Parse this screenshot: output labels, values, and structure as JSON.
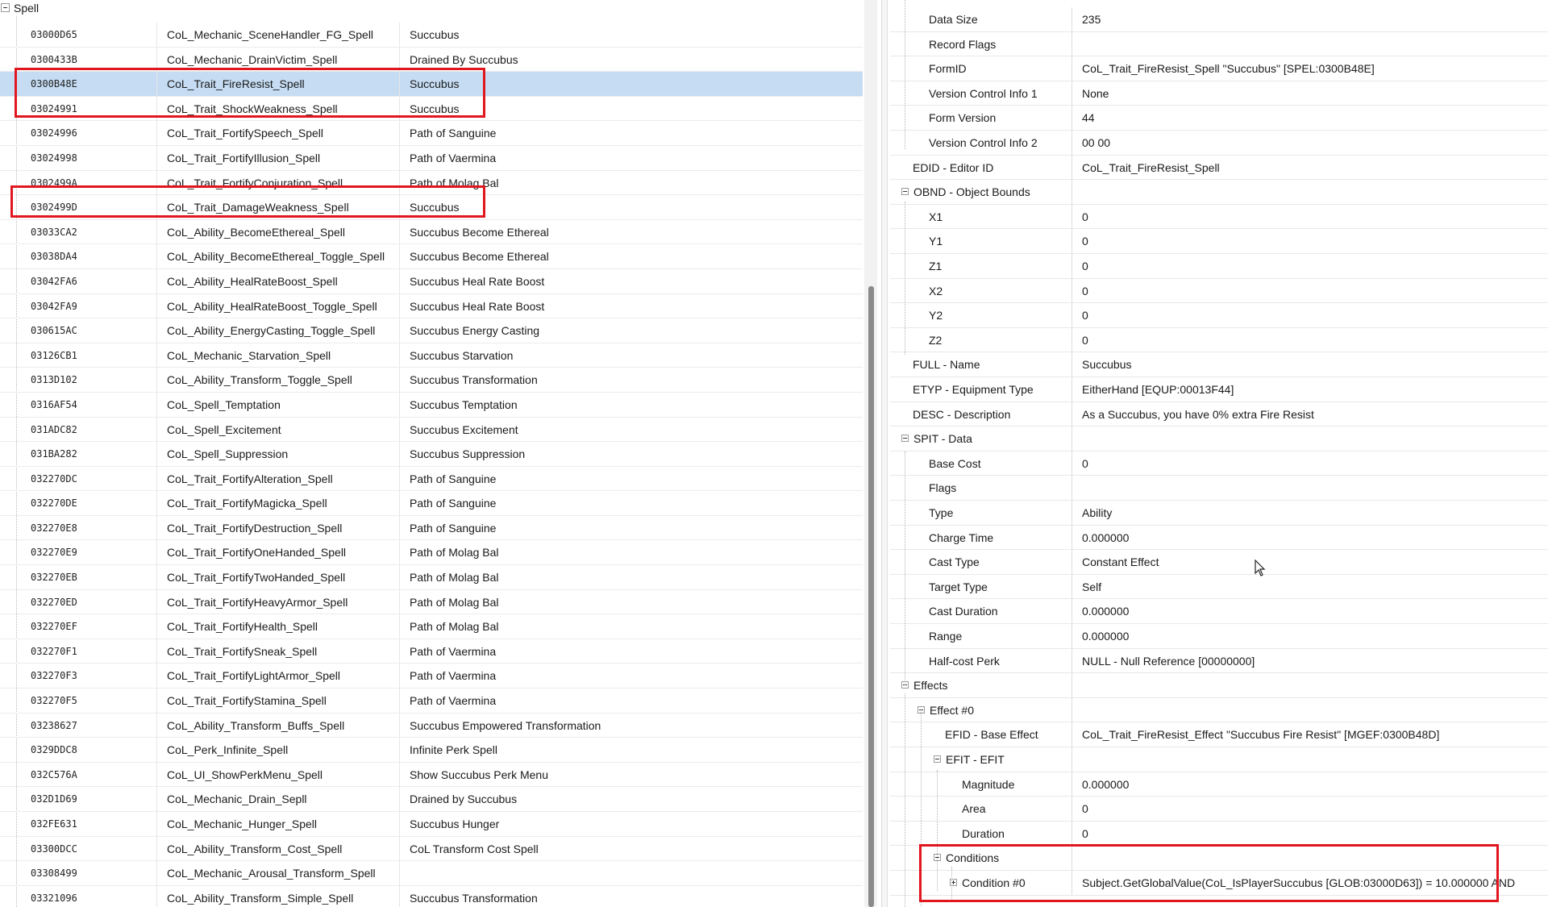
{
  "left_tree": {
    "root_label": "Spell",
    "rows": [
      {
        "id": "03000D65",
        "edid": "CoL_Mechanic_SceneHandler_FG_Spell",
        "name": "Succubus"
      },
      {
        "id": "0300433B",
        "edid": "CoL_Mechanic_DrainVictim_Spell",
        "name": "Drained By Succubus"
      },
      {
        "id": "0300B48E",
        "edid": "CoL_Trait_FireResist_Spell",
        "name": "Succubus",
        "selected": true
      },
      {
        "id": "03024991",
        "edid": "CoL_Trait_ShockWeakness_Spell",
        "name": "Succubus"
      },
      {
        "id": "03024996",
        "edid": "CoL_Trait_FortifySpeech_Spell",
        "name": "Path of Sanguine"
      },
      {
        "id": "03024998",
        "edid": "CoL_Trait_FortifyIllusion_Spell",
        "name": "Path of Vaermina"
      },
      {
        "id": "0302499A",
        "edid": "CoL_Trait_FortifyConjuration_Spell",
        "name": "Path of Molag Bal"
      },
      {
        "id": "0302499D",
        "edid": "CoL_Trait_DamageWeakness_Spell",
        "name": "Succubus"
      },
      {
        "id": "03033CA2",
        "edid": "CoL_Ability_BecomeEthereal_Spell",
        "name": "Succubus Become Ethereal"
      },
      {
        "id": "03038DA4",
        "edid": "CoL_Ability_BecomeEthereal_Toggle_Spell",
        "name": "Succubus Become Ethereal"
      },
      {
        "id": "03042FA6",
        "edid": "CoL_Ability_HealRateBoost_Spell",
        "name": "Succubus Heal Rate Boost"
      },
      {
        "id": "03042FA9",
        "edid": "CoL_Ability_HealRateBoost_Toggle_Spell",
        "name": "Succubus Heal Rate Boost"
      },
      {
        "id": "030615AC",
        "edid": "CoL_Ability_EnergyCasting_Toggle_Spell",
        "name": "Succubus Energy Casting"
      },
      {
        "id": "03126CB1",
        "edid": "CoL_Mechanic_Starvation_Spell",
        "name": "Succubus Starvation"
      },
      {
        "id": "0313D102",
        "edid": "CoL_Ability_Transform_Toggle_Spell",
        "name": "Succubus Transformation"
      },
      {
        "id": "0316AF54",
        "edid": "CoL_Spell_Temptation",
        "name": "Succubus Temptation"
      },
      {
        "id": "031ADC82",
        "edid": "CoL_Spell_Excitement",
        "name": "Succubus Excitement"
      },
      {
        "id": "031BA282",
        "edid": "CoL_Spell_Suppression",
        "name": "Succubus Suppression"
      },
      {
        "id": "032270DC",
        "edid": "CoL_Trait_FortifyAlteration_Spell",
        "name": "Path of Sanguine"
      },
      {
        "id": "032270DE",
        "edid": "CoL_Trait_FortifyMagicka_Spell",
        "name": "Path of Sanguine"
      },
      {
        "id": "032270E8",
        "edid": "CoL_Trait_FortifyDestruction_Spell",
        "name": "Path of Sanguine"
      },
      {
        "id": "032270E9",
        "edid": "CoL_Trait_FortifyOneHanded_Spell",
        "name": "Path of Molag Bal"
      },
      {
        "id": "032270EB",
        "edid": "CoL_Trait_FortifyTwoHanded_Spell",
        "name": "Path of Molag Bal"
      },
      {
        "id": "032270ED",
        "edid": "CoL_Trait_FortifyHeavyArmor_Spell",
        "name": "Path of Molag Bal"
      },
      {
        "id": "032270EF",
        "edid": "CoL_Trait_FortifyHealth_Spell",
        "name": "Path of Molag Bal"
      },
      {
        "id": "032270F1",
        "edid": "CoL_Trait_FortifySneak_Spell",
        "name": "Path of Vaermina"
      },
      {
        "id": "032270F3",
        "edid": "CoL_Trait_FortifyLightArmor_Spell",
        "name": "Path of Vaermina"
      },
      {
        "id": "032270F5",
        "edid": "CoL_Trait_FortifyStamina_Spell",
        "name": "Path of Vaermina"
      },
      {
        "id": "03238627",
        "edid": "CoL_Ability_Transform_Buffs_Spell",
        "name": "Succubus Empowered Transformation"
      },
      {
        "id": "0329DDC8",
        "edid": "CoL_Perk_Infinite_Spell",
        "name": "Infinite Perk Spell"
      },
      {
        "id": "032C576A",
        "edid": "CoL_UI_ShowPerkMenu_Spell",
        "name": "Show Succubus Perk Menu"
      },
      {
        "id": "032D1D69",
        "edid": "CoL_Mechanic_Drain_Sepll",
        "name": "Drained by Succubus"
      },
      {
        "id": "032FE631",
        "edid": "CoL_Mechanic_Hunger_Spell",
        "name": "Succubus Hunger"
      },
      {
        "id": "03300DCC",
        "edid": "CoL_Ability_Transform_Cost_Spell",
        "name": "CoL Transform Cost Spell"
      },
      {
        "id": "03308499",
        "edid": "CoL_Mechanic_Arousal_Transform_Spell",
        "name": ""
      },
      {
        "id": "03321096",
        "edid": "CoL_Ability_Transform_Simple_Spell",
        "name": "Succubus Transformation"
      }
    ]
  },
  "record_view": {
    "rows": [
      {
        "key": "Data Size",
        "value": "235",
        "indent": 1
      },
      {
        "key": "Record Flags",
        "value": "",
        "indent": 1
      },
      {
        "key": "FormID",
        "value": "CoL_Trait_FireResist_Spell \"Succubus\" [SPEL:0300B48E]",
        "indent": 1
      },
      {
        "key": "Version Control Info 1",
        "value": "None",
        "indent": 1
      },
      {
        "key": "Form Version",
        "value": "44",
        "indent": 1
      },
      {
        "key": "Version Control Info 2",
        "value": "00 00",
        "indent": 1
      },
      {
        "key": "EDID - Editor ID",
        "value": "CoL_Trait_FireResist_Spell",
        "indent": 0
      },
      {
        "key": "OBND - Object Bounds",
        "value": "",
        "indent": 0,
        "expander": "minus"
      },
      {
        "key": "X1",
        "value": "0",
        "indent": 1
      },
      {
        "key": "Y1",
        "value": "0",
        "indent": 1
      },
      {
        "key": "Z1",
        "value": "0",
        "indent": 1
      },
      {
        "key": "X2",
        "value": "0",
        "indent": 1
      },
      {
        "key": "Y2",
        "value": "0",
        "indent": 1
      },
      {
        "key": "Z2",
        "value": "0",
        "indent": 1
      },
      {
        "key": "FULL - Name",
        "value": "Succubus",
        "indent": 0
      },
      {
        "key": "ETYP - Equipment Type",
        "value": "EitherHand [EQUP:00013F44]",
        "indent": 0
      },
      {
        "key": "DESC - Description",
        "value": "As a Succubus, you have 0% extra Fire Resist",
        "indent": 0
      },
      {
        "key": "SPIT - Data",
        "value": "",
        "indent": 0,
        "expander": "minus"
      },
      {
        "key": "Base Cost",
        "value": "0",
        "indent": 1
      },
      {
        "key": "Flags",
        "value": "",
        "indent": 1
      },
      {
        "key": "Type",
        "value": "Ability",
        "indent": 1
      },
      {
        "key": "Charge Time",
        "value": "0.000000",
        "indent": 1
      },
      {
        "key": "Cast Type",
        "value": "Constant Effect",
        "indent": 1
      },
      {
        "key": "Target Type",
        "value": "Self",
        "indent": 1
      },
      {
        "key": "Cast Duration",
        "value": "0.000000",
        "indent": 1
      },
      {
        "key": "Range",
        "value": "0.000000",
        "indent": 1
      },
      {
        "key": "Half-cost Perk",
        "value": "NULL - Null Reference [00000000]",
        "indent": 1
      },
      {
        "key": "Effects",
        "value": "",
        "indent": 0,
        "expander": "minus"
      },
      {
        "key": "Effect #0",
        "value": "",
        "indent": 1,
        "expander": "minus"
      },
      {
        "key": "EFID - Base Effect",
        "value": "CoL_Trait_FireResist_Effect \"Succubus Fire Resist\" [MGEF:0300B48D]",
        "indent": 2
      },
      {
        "key": "EFIT - EFIT",
        "value": "",
        "indent": 2,
        "expander": "minus"
      },
      {
        "key": "Magnitude",
        "value": "0.000000",
        "indent": 3
      },
      {
        "key": "Area",
        "value": "0",
        "indent": 3
      },
      {
        "key": "Duration",
        "value": "0",
        "indent": 3
      },
      {
        "key": "Conditions",
        "value": "",
        "indent": 2,
        "expander": "minus"
      },
      {
        "key": "Condition #0",
        "value": "Subject.GetGlobalValue(CoL_IsPlayerSuccubus [GLOB:03000D63]) = 10.000000 AND",
        "indent": 3,
        "expander": "plus"
      }
    ]
  },
  "colors": {
    "selection": "#c5dcf3",
    "highlight_box": "#e0171e"
  }
}
